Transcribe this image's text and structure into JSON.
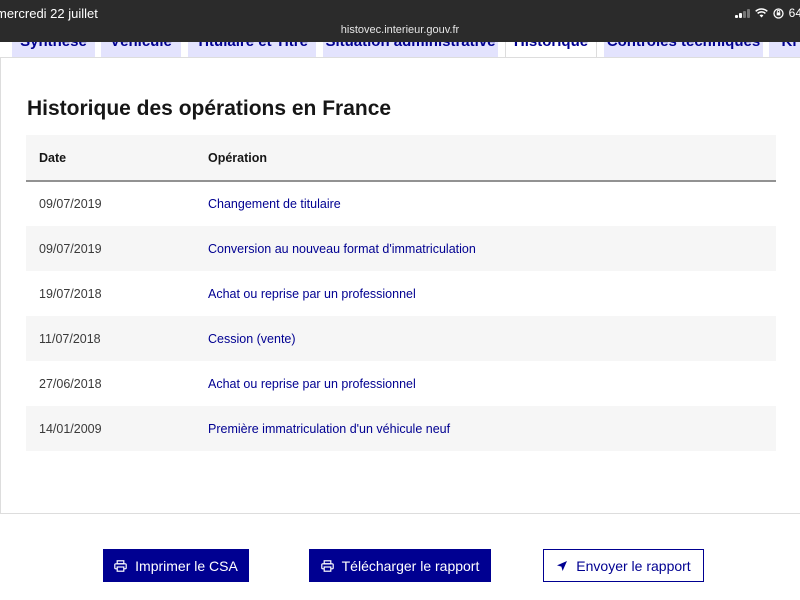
{
  "status_bar": {
    "time": "mercredi 22 juillet",
    "url": "histovec.interieur.gouv.fr",
    "battery": "64"
  },
  "tabs": [
    {
      "label": "Synthèse",
      "active": false
    },
    {
      "label": "Véhicule",
      "active": false
    },
    {
      "label": "Titulaire et Titre",
      "active": false
    },
    {
      "label": "Situation administrative",
      "active": false
    },
    {
      "label": "Historique",
      "active": true
    },
    {
      "label": "Contrôles techniques",
      "active": false
    },
    {
      "label": "Ki",
      "active": false
    }
  ],
  "history": {
    "title": "Historique des opérations en France",
    "columns": {
      "date": "Date",
      "operation": "Opération"
    },
    "rows": [
      {
        "date": "09/07/2019",
        "operation": "Changement de titulaire"
      },
      {
        "date": "09/07/2019",
        "operation": "Conversion au nouveau format d'immatriculation"
      },
      {
        "date": "19/07/2018",
        "operation": "Achat ou reprise par un professionnel"
      },
      {
        "date": "11/07/2018",
        "operation": "Cession (vente)"
      },
      {
        "date": "27/06/2018",
        "operation": "Achat ou reprise par un professionnel"
      },
      {
        "date": "14/01/2009",
        "operation": "Première immatriculation d'un véhicule neuf"
      }
    ]
  },
  "actions": {
    "print_label": "Imprimer le CSA",
    "download_label": "Télécharger le rapport",
    "send_label": "Envoyer le rapport"
  },
  "colors": {
    "primary": "#000091",
    "tab_bg": "#e3e3fd",
    "status_bar": "#2b2b2b"
  }
}
